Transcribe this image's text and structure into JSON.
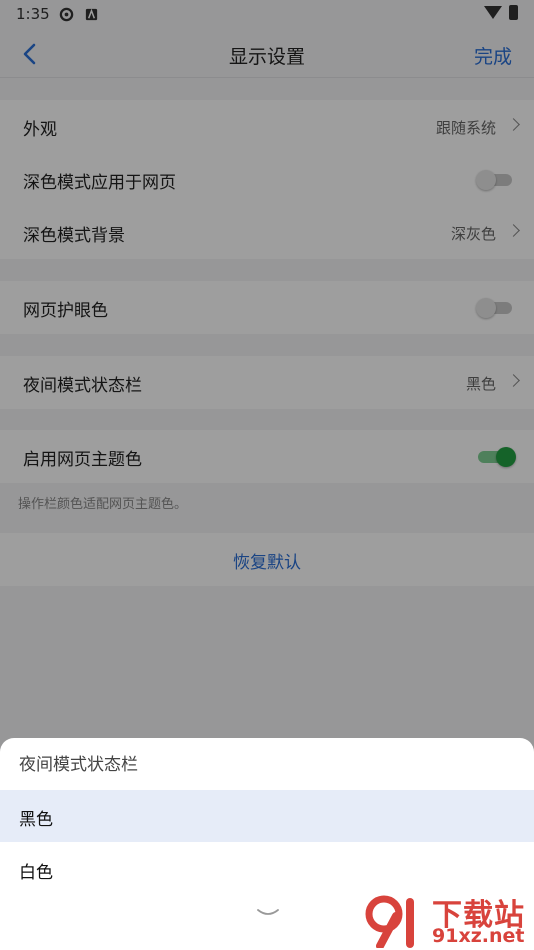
{
  "status_bar": {
    "time": "1:35"
  },
  "nav": {
    "title": "显示设置",
    "done": "完成"
  },
  "groups": {
    "g1": [
      {
        "label": "外观",
        "value": "跟随系统"
      },
      {
        "label": "深色模式应用于网页",
        "toggle": false
      },
      {
        "label": "深色模式背景",
        "value": "深灰色"
      }
    ],
    "g2": [
      {
        "label": "网页护眼色",
        "toggle": false
      }
    ],
    "g3": [
      {
        "label": "夜间模式状态栏",
        "value": "黑色"
      }
    ],
    "g4": [
      {
        "label": "启用网页主题色",
        "toggle": true
      }
    ]
  },
  "hint": "操作栏颜色适配网页主题色。",
  "restore": "恢复默认",
  "sheet": {
    "title": "夜间模式状态栏",
    "options": [
      {
        "label": "黑色",
        "selected": true
      },
      {
        "label": "白色",
        "selected": false
      }
    ]
  },
  "watermark": {
    "top": "下载站",
    "bottom": "91xz.net"
  },
  "colors": {
    "accent": "#2a6fd6",
    "toggle_on": "#22a043",
    "watermark": "#d8433c"
  }
}
